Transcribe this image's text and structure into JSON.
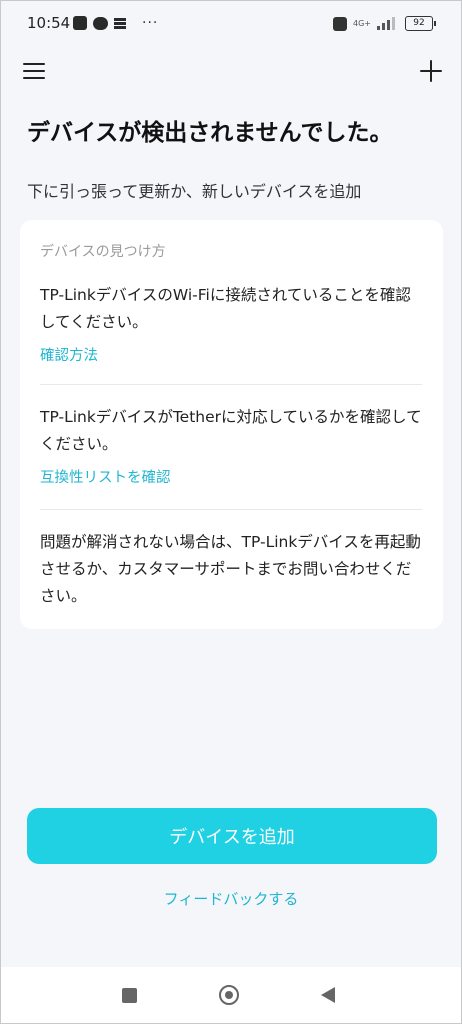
{
  "status_bar": {
    "time": "10:54",
    "more": "···",
    "network": "4G+",
    "battery": "92",
    "signal_level": 3
  },
  "header": {
    "menu_icon": "hamburger-menu-icon",
    "add_icon": "plus-icon"
  },
  "page": {
    "title": "デバイスが検出されませんでした。",
    "subtitle": "下に引っ張って更新か、新しいデバイスを追加"
  },
  "card": {
    "heading": "デバイスの見つけ方",
    "sections": [
      {
        "text": "TP-LinkデバイスのWi-Fiに接続されていることを確認してください。",
        "link": "確認方法"
      },
      {
        "text": "TP-LinkデバイスがTetherに対応しているかを確認してください。",
        "link": "互換性リストを確認"
      },
      {
        "text": "問題が解消されない場合は、TP-Linkデバイスを再起動させるか、カスタマーサポートまでお問い合わせください。"
      }
    ]
  },
  "actions": {
    "add_device_label": "デバイスを追加",
    "feedback_label": "フィードバックする"
  },
  "colors": {
    "accent": "#1fd1e3",
    "link": "#1fb6d1",
    "background": "#f5f6fa",
    "card": "#ffffff"
  },
  "nav_bar": {
    "icons": [
      "recents-icon",
      "home-icon",
      "back-icon"
    ]
  }
}
